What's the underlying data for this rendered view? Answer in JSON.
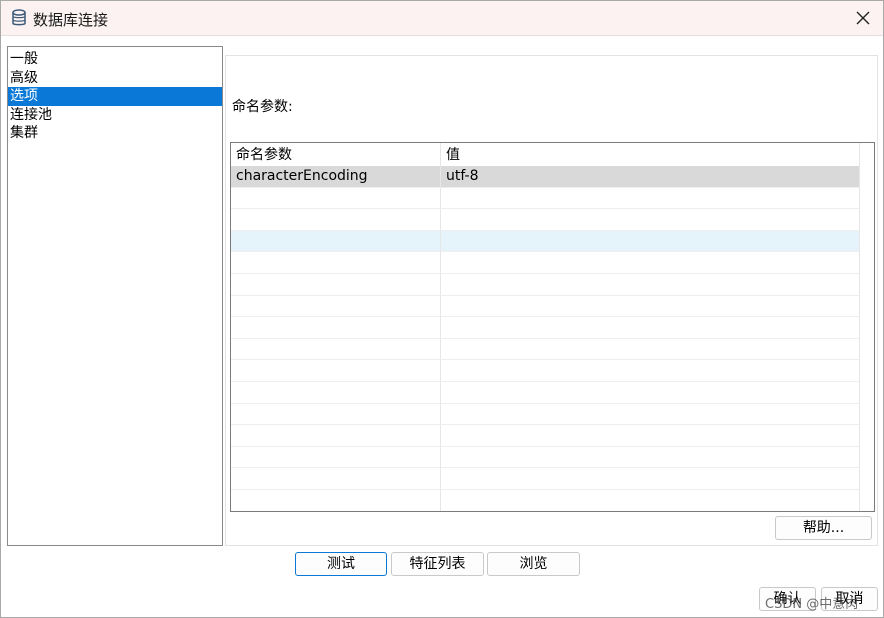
{
  "window": {
    "title": "数据库连接"
  },
  "sidebar": {
    "items": [
      {
        "label": "一般"
      },
      {
        "label": "高级"
      },
      {
        "label": "选项"
      },
      {
        "label": "连接池"
      },
      {
        "label": "集群"
      }
    ],
    "selected": "选项"
  },
  "options": {
    "section_label": "命名参数:",
    "table": {
      "columns": [
        "命名参数",
        "值"
      ],
      "rows": [
        {
          "name": "characterEncoding",
          "value": "utf-8"
        }
      ]
    },
    "help_label": "帮助..."
  },
  "buttons": {
    "test": "测试",
    "feature_list": "特征列表",
    "browse": "浏览",
    "ok": "确认",
    "cancel": "取消"
  },
  "watermark": "CSDN @中意肉",
  "colors": {
    "accent": "#0a78d7",
    "selected_row": "#d9d9d9",
    "hover_row": "#e5f3fb",
    "titlebar": "#fbf2f1"
  }
}
